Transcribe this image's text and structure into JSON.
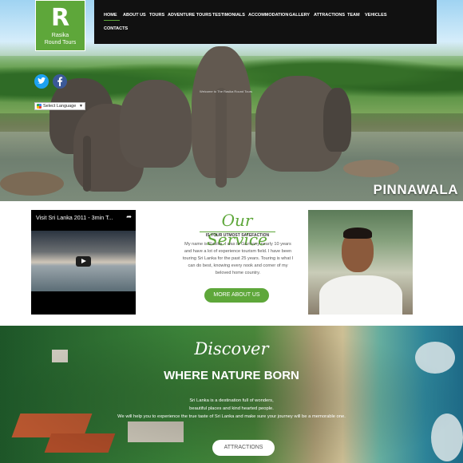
{
  "logo": {
    "mark": "R",
    "name_line1": "Rasika",
    "name_line2": "Round Tours"
  },
  "nav": {
    "items": [
      "HOME",
      "ABOUT US",
      "TOURS",
      "ADVENTURE TOURS",
      "TESTIMONIALS",
      "ACCOMMODATION",
      "GALLERY",
      "ATTRACTIONS",
      "TEAM",
      "VEHICLES",
      "CONTACTS"
    ],
    "active": "HOME"
  },
  "hero": {
    "caption": "PINNAWALA",
    "welcome": "Welcome to The Rasika Round Tours"
  },
  "social": {
    "twitter_icon": "twitter-icon",
    "facebook_icon": "facebook-icon"
  },
  "language": {
    "label": "Select Language"
  },
  "video": {
    "title": "Visit Sri Lanka 2011 - 3min T..."
  },
  "service": {
    "script_title": "Our Service",
    "subtitle": "IS YOUR UTMOST SATEFACTION",
    "text": "My name is Rasika. I was in Germany nearly 10 years and have a lot of experience tourism field. I have been touring Sri Lanka for the past 25 years. Touring is what I can do best, knowing every nook and corner of my beloved home country.",
    "button": "MORE ABOUT US"
  },
  "discover": {
    "script_title": "Discover",
    "title": "WHERE NATURE BORN",
    "line1": "Sri Lanka is a destination full of wonders,",
    "line2": "beautiful places and kind hearted people.",
    "line3": "We will help you to experience the true taste of Sri Lanka and make sure your journey will be a memorable one.",
    "button": "ATTRACTIONS"
  },
  "colors": {
    "brand_green": "#5ea73a",
    "nav_bg": "#111111"
  }
}
